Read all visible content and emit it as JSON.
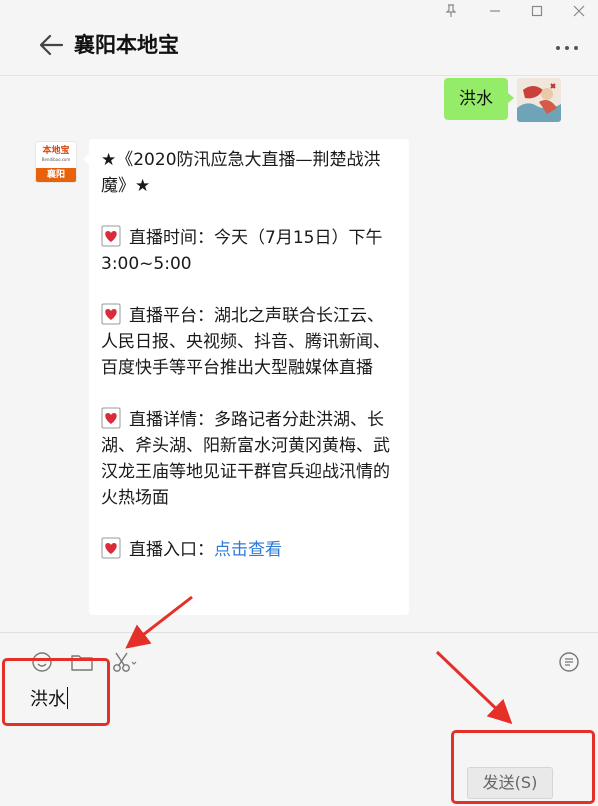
{
  "window": {
    "title": "襄阳本地宝",
    "controls": {
      "pin_icon": "pin-icon",
      "minimize_icon": "minimize-icon",
      "maximize_icon": "maximize-icon",
      "close_icon": "close-icon"
    },
    "more_icon": "more-dots-icon",
    "back_icon": "back-arrow-icon"
  },
  "messages": {
    "outgoing": {
      "text": "洪水"
    },
    "incoming": {
      "avatar": {
        "brand": "本地宝",
        "site": "Bendibao.com",
        "city": "襄阳"
      },
      "title": "★《2020防汛应急大直播—荆楚战洪魔》★",
      "items": [
        {
          "icon": "heart-letter-icon",
          "text": "直播时间：今天（7月15日）下午3:00~5:00"
        },
        {
          "icon": "heart-letter-icon",
          "text": "直播平台：湖北之声联合长江云、人民日报、央视频、抖音、腾讯新闻、百度快手等平台推出大型融媒体直播"
        },
        {
          "icon": "heart-letter-icon",
          "text": "直播详情：多路记者分赴洪湖、长湖、斧头湖、阳新富水河黄冈黄梅、武汉龙王庙等地见证干群官兵迎战汛情的火热场面"
        }
      ],
      "entry_label": "直播入口：",
      "entry_link": "点击查看"
    }
  },
  "input": {
    "toolbar": [
      "emoji-icon",
      "folder-icon",
      "scissors-icon",
      "chat-history-icon"
    ],
    "value": "洪水",
    "send_label": "发送(S)"
  },
  "colors": {
    "outgoing_bubble": "#95ec69",
    "link": "#2f7ad6",
    "annotation": "#e5302a",
    "brand_orange": "#e8620c"
  }
}
